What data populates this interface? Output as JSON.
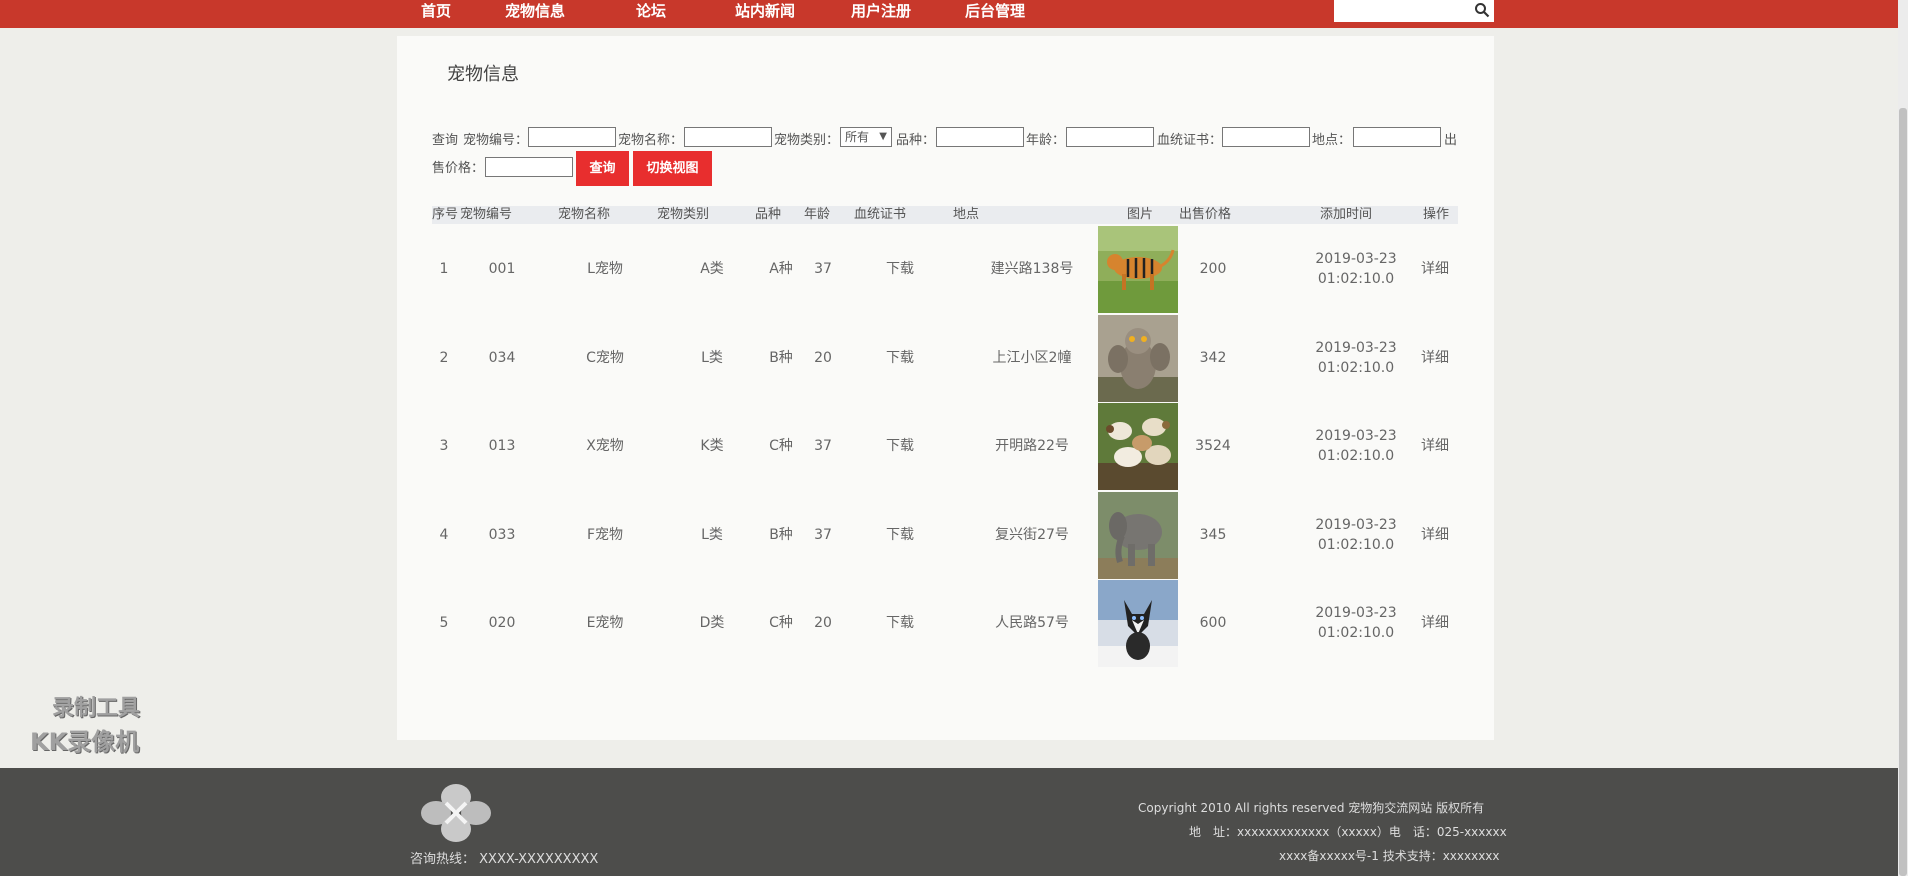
{
  "nav": {
    "items": [
      {
        "label": "首页"
      },
      {
        "label": "宠物信息"
      },
      {
        "label": "论坛"
      },
      {
        "label": "站内新闻"
      },
      {
        "label": "用户注册"
      },
      {
        "label": "后台管理"
      }
    ],
    "search": {
      "placeholder": "",
      "icon": "search-icon"
    }
  },
  "page": {
    "title": "宠物信息"
  },
  "filter": {
    "query_label": "查询",
    "pet_no_label": "宠物编号：",
    "pet_name_label": "宠物名称：",
    "category_label": "宠物类别：",
    "category_value": "所有",
    "breed_label": "品种：",
    "age_label": "年龄：",
    "pedigree_label": "血统证书：",
    "location_label": "地点：",
    "price_label_1": "出",
    "price_label_2": "售价格：",
    "search_button": "查询",
    "switch_button": "切换视图"
  },
  "table": {
    "headers": [
      "序号",
      "宠物编号",
      "宠物名称",
      "宠物类别",
      "品种",
      "年龄",
      "血统证书",
      "地点",
      "图片",
      "出售价格",
      "添加时间",
      "操作"
    ],
    "rows": [
      {
        "idx": "1",
        "no": "001",
        "name": "L宠物",
        "cat": "A类",
        "breed": "A种",
        "age": "37",
        "cert": "下载",
        "loc": "建兴路138号",
        "pic": "tiger",
        "price": "200",
        "date": "2019-03-23",
        "time": "01:02:10.0",
        "op": "详细"
      },
      {
        "idx": "2",
        "no": "034",
        "name": "C宠物",
        "cat": "L类",
        "breed": "B种",
        "age": "20",
        "cert": "下载",
        "loc": "上江小区2幢",
        "pic": "owl",
        "price": "342",
        "date": "2019-03-23",
        "time": "01:02:10.0",
        "op": "详细"
      },
      {
        "idx": "3",
        "no": "013",
        "name": "X宠物",
        "cat": "K类",
        "breed": "C种",
        "age": "37",
        "cert": "下载",
        "loc": "开明路22号",
        "pic": "sheep",
        "price": "3524",
        "date": "2019-03-23",
        "time": "01:02:10.0",
        "op": "详细"
      },
      {
        "idx": "4",
        "no": "033",
        "name": "F宠物",
        "cat": "L类",
        "breed": "B种",
        "age": "37",
        "cert": "下载",
        "loc": "复兴街27号",
        "pic": "elephant",
        "price": "345",
        "date": "2019-03-23",
        "time": "01:02:10.0",
        "op": "详细"
      },
      {
        "idx": "5",
        "no": "020",
        "name": "E宠物",
        "cat": "D类",
        "breed": "C种",
        "age": "20",
        "cert": "下载",
        "loc": "人民路57号",
        "pic": "husky",
        "price": "600",
        "date": "2019-03-23",
        "time": "01:02:10.0",
        "op": "详细"
      }
    ]
  },
  "footer": {
    "hotline": "咨询热线： XXXX-XXXXXXXXX",
    "copyright": "Copyright 2010 All rights reserved 宠物狗交流网站 版权所有",
    "address": "地　址：xxxxxxxxxxxxx（xxxxx）电　话：025-xxxxxx",
    "icp": "xxxx备xxxxx号-1 技术支持：xxxxxxxx"
  },
  "watermark": {
    "line1": "录制工具",
    "line2": "KK录像机"
  },
  "colors": {
    "nav_bg": "#c8382b",
    "button": "#e82e2e",
    "footer_bg": "#4d4d4b"
  }
}
